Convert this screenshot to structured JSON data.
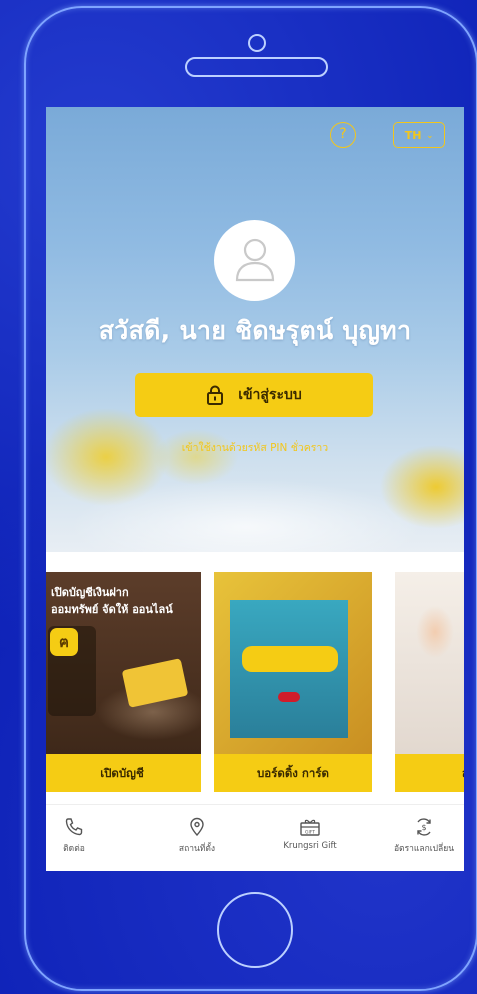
{
  "header": {
    "help_icon_label": "?",
    "language": "TH",
    "language_chevron": "⌄"
  },
  "greeting": "สวัสดี, นาย ชิดษรุตน์ บุญทา",
  "login": {
    "label": "เข้าสู่ระบบ"
  },
  "pin_link": "เข้าใช้งานด้วยรหัส PIN ชั่วคราว",
  "promo_cards": [
    {
      "overlay_text_line1": "เปิดบัญชีเงินฝาก",
      "overlay_text_line2": "ออมทรัพย์ จัดให้ ออนไลน์",
      "label": "เปิดบัญชี"
    },
    {
      "label": "บอร์ดดิ้ง การ์ด"
    },
    {
      "label": "ส"
    }
  ],
  "nav": [
    {
      "label": "ติดต่อ",
      "icon": "phone-icon"
    },
    {
      "label": "สถานที่ตั้ง",
      "icon": "location-icon"
    },
    {
      "label": "Krungsri Gift",
      "icon": "gift-icon"
    },
    {
      "label": "อัตราแลกเปลี่ยน",
      "icon": "exchange-icon"
    }
  ],
  "colors": {
    "accent_yellow": "#f5cc14",
    "background_blue": "#0c20b5",
    "phone_outline": "#7fa4ff"
  }
}
